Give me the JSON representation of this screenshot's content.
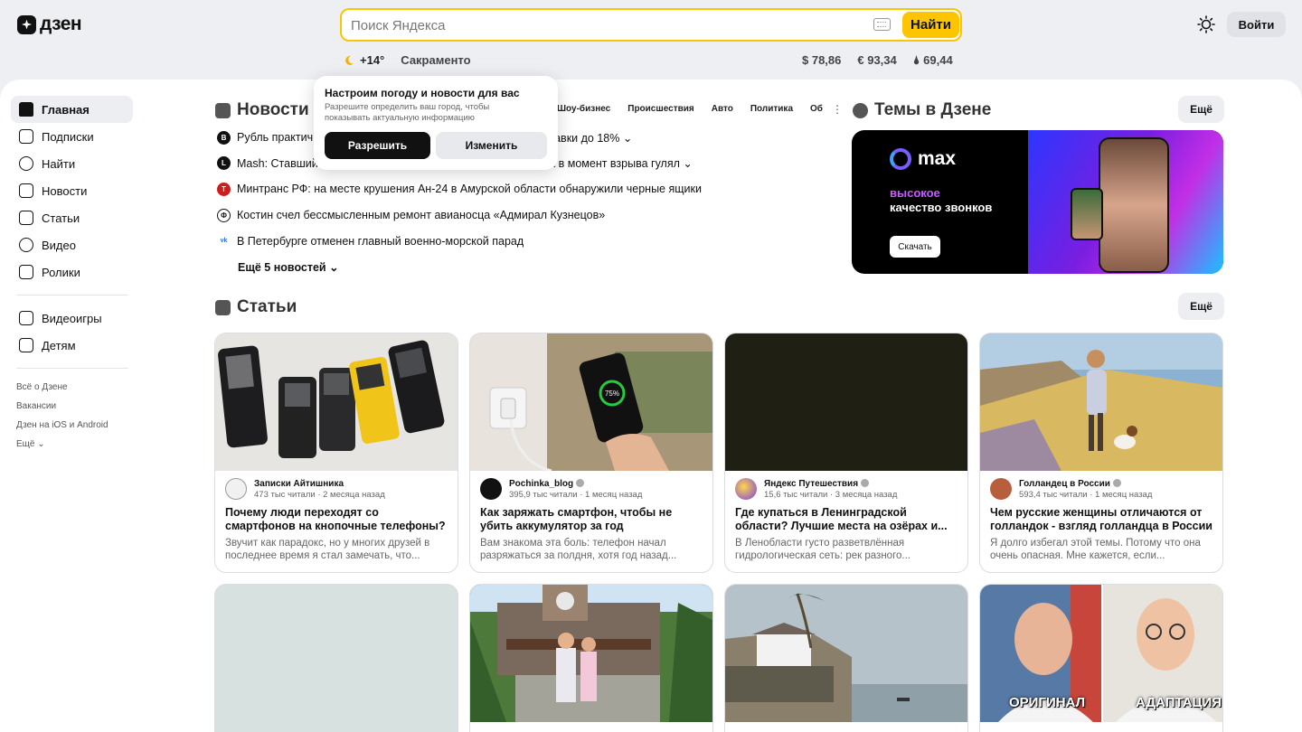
{
  "header": {
    "logo_text": "дзен",
    "search_placeholder": "Поиск Яндекса",
    "search_button": "Найти",
    "login_button": "Войти"
  },
  "weather": {
    "temp": "+14°",
    "city": "Сакраменто"
  },
  "rates": {
    "usd": "$ 78,86",
    "eur": "€ 93,34",
    "oil": "🌢 69,44"
  },
  "sidebar": {
    "items": [
      {
        "label": "Главная",
        "icon": "home-icon"
      },
      {
        "label": "Подписки",
        "icon": "subscriptions-icon"
      },
      {
        "label": "Найти",
        "icon": "search-icon"
      },
      {
        "label": "Новости",
        "icon": "news-icon"
      },
      {
        "label": "Статьи",
        "icon": "articles-icon"
      },
      {
        "label": "Видео",
        "icon": "video-icon"
      },
      {
        "label": "Ролики",
        "icon": "shorts-icon"
      }
    ],
    "items2": [
      {
        "label": "Видеоигры",
        "icon": "gamepad-icon"
      },
      {
        "label": "Детям",
        "icon": "kids-icon"
      }
    ],
    "links": [
      "Всё о Дзене",
      "Вакансии",
      "Дзен на iOS и Android",
      "Ещё ⌄"
    ]
  },
  "news": {
    "title": "Новости",
    "tabs": [
      "Шоу-бизнес",
      "Происшествия",
      "Авто",
      "Политика",
      "Об"
    ],
    "items": [
      {
        "text": "Рубль практич",
        "suffix": "авки до 18% ⌄",
        "icon": "B"
      },
      {
        "text": "Mash: Ставший",
        "suffix": "ок в момент взрыва гулял ⌄",
        "icon": "L"
      },
      {
        "text": "Минтранс РФ: на месте крушения Ан-24 в Амурской области обнаружили черные ящики",
        "suffix": "",
        "icon": "T"
      },
      {
        "text": "Костин счел бессмысленным ремонт авианосца «Адмирал Кузнецов»",
        "suffix": "",
        "icon": "Ф"
      },
      {
        "text": "В Петербурге отменен главный военно-морской парад",
        "suffix": "",
        "icon": "vk"
      }
    ],
    "more": "Ещё 5 новостей ⌄"
  },
  "popup": {
    "title": "Настроим погоду и новости для вас",
    "text": "Разрешите определить ваш город, чтобы показывать актуальную информацию",
    "allow": "Разрешить",
    "change": "Изменить"
  },
  "topics": {
    "title": "Темы в Дзене",
    "more": "Ещё",
    "promo": {
      "brand": "max",
      "line1": "высокое",
      "line2": "качество звонков",
      "button": "Скачать"
    }
  },
  "articles": {
    "title": "Статьи",
    "more": "Ещё",
    "cards": [
      {
        "author": "Записки Айтишника",
        "meta": "473 тыс читали · 2 месяца назад",
        "title": "Почему люди переходят со смартфонов на кнопочные телефоны?",
        "text": "Звучит как парадокс, но у многих друзей в последнее время я стал замечать, что...",
        "verified": false
      },
      {
        "author": "Pochinka_blog",
        "meta": "395,9 тыс читали · 1 месяц назад",
        "title": "Как заряжать смартфон, чтобы не убить аккумулятор за год",
        "text": "Вам знакома эта боль: телефон начал разряжаться за полдня, хотя год назад...",
        "verified": true,
        "img_text": "75%"
      },
      {
        "author": "Яндекс Путешествия",
        "meta": "15,6 тыс читали · 3 месяца назад",
        "title": "Где купаться в Ленинградской области? Лучшие места на озёрах и...",
        "text": "В Ленобласти густо разветвлённая гидрологическая сеть: рек разного...",
        "verified": true
      },
      {
        "author": "Голландец в России",
        "meta": "593,4 тыс читали · 1 месяц назад",
        "title": "Чем русские женщины отличаются от голландок - взгляд голландца в России",
        "text": "Я долго избегал этой темы. Потому что она очень опасная. Мне кажется, если...",
        "verified": true
      }
    ],
    "cards2": [
      {
        "meme_left": "",
        "meme_right": ""
      },
      {
        "meme_left": "",
        "meme_right": ""
      },
      {
        "meme_left": "",
        "meme_right": ""
      },
      {
        "meme_left": "ОРИГИНАЛ",
        "meme_right": "АДАПТАЦИЯ"
      }
    ]
  }
}
